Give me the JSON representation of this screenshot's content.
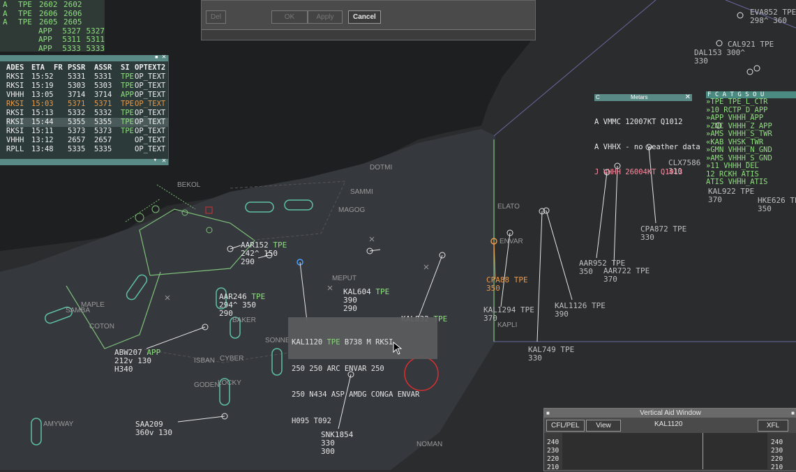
{
  "top_list": {
    "rows": [
      {
        "a": "A",
        "b": "TPE",
        "c": "2602",
        "d": "2602"
      },
      {
        "a": "A",
        "b": "TPE",
        "c": "2606",
        "d": "2606"
      },
      {
        "a": "A",
        "b": "TPE",
        "c": "2605",
        "d": "2605"
      },
      {
        "a": "",
        "b": "APP",
        "c": "5327",
        "d": "5327"
      },
      {
        "a": "",
        "b": "APP",
        "c": "5311",
        "d": "5311"
      },
      {
        "a": "",
        "b": "APP",
        "c": "5333",
        "d": "5333"
      }
    ]
  },
  "flight_list": {
    "headers": [
      "ADES",
      "ETA",
      "FR",
      "PSSR",
      "ASSR",
      "SI",
      "OPTEXT2"
    ],
    "rows": [
      {
        "ades": "RKSI",
        "eta": "15:52",
        "pssr": "5331",
        "assr": "5331",
        "si": "TPE",
        "opt": "OP_TEXT",
        "style": "normal"
      },
      {
        "ades": "RKSI",
        "eta": "15:19",
        "pssr": "5303",
        "assr": "5303",
        "si": "TPE",
        "opt": "OP_TEXT",
        "style": "normal"
      },
      {
        "ades": "VHHH",
        "eta": "13:05",
        "pssr": "3714",
        "assr": "3714",
        "si": "APP",
        "opt": "OP_TEXT",
        "style": "normal"
      },
      {
        "ades": "RKSI",
        "eta": "15:03",
        "pssr": "5371",
        "assr": "5371",
        "si": "TPE",
        "opt": "OP_TEXT",
        "style": "orange"
      },
      {
        "ades": "RKSI",
        "eta": "15:13",
        "pssr": "5332",
        "assr": "5332",
        "si": "TPE",
        "opt": "OP_TEXT",
        "style": "normal"
      },
      {
        "ades": "RKSI",
        "eta": "15:44",
        "pssr": "5355",
        "assr": "5355",
        "si": "TPE",
        "opt": "OP_TEXT",
        "style": "hl"
      },
      {
        "ades": "RKSI",
        "eta": "15:11",
        "pssr": "5373",
        "assr": "5373",
        "si": "TPE",
        "opt": "OP_TEXT",
        "style": "normal"
      },
      {
        "ades": "VHHH",
        "eta": "13:12",
        "pssr": "2657",
        "assr": "2657",
        "si": "",
        "opt": "OP_TEXT",
        "style": "normal"
      },
      {
        "ades": "RPLL",
        "eta": "13:48",
        "pssr": "5335",
        "assr": "5335",
        "si": "",
        "opt": "OP_TEXT",
        "style": "normal"
      }
    ]
  },
  "dialog": {
    "buttons": [
      "Del",
      "OK",
      "Apply",
      "Cancel"
    ]
  },
  "metars": {
    "title": "Metars",
    "lines": [
      {
        "text": "A VMMC 12007KT Q1012",
        "color": "normal"
      },
      {
        "text": "A VHHX - no weather data",
        "color": "normal"
      },
      {
        "text": "J VHHH 26004KT Q1013",
        "color": "pink"
      }
    ]
  },
  "freq_panel": {
    "header": "F C A T G S O U",
    "lines": [
      "»TPE TPE_L_CTR",
      "»10 RCTP_D_APP",
      "»APP VHHH_APP",
      "»ZNC VHHH_Z_APP",
      "»AMS VHHH_S_TWR",
      "«KAB VHSK_TWR",
      "»GMN VHHH_N_GND",
      "»AMS VHHH_S_GND",
      "»11 VHHH_DEL",
      "12 RCKH_ATIS",
      "ATIS VHHH_ATIS"
    ]
  },
  "waypoints": [
    "BEKOL",
    "DOTMI",
    "SAMMI",
    "MAGOG",
    "ELATO",
    "ENVAR",
    "MEPUT",
    "MAPLE",
    "SAMBA",
    "COTON",
    "BAKER",
    "SONNE",
    "ISBAN",
    "CYBER",
    "GODEN",
    "LOCKY",
    "AMYWAY",
    "KAPLI",
    "NOMAN"
  ],
  "aircraft": [
    {
      "cs": "AAR152",
      "si": "TPE",
      "l2": "242^ 150",
      "l3": "290"
    },
    {
      "cs": "AAR246",
      "si": "TPE",
      "l2": "294^ 350",
      "l3": "290"
    },
    {
      "cs": "KAL604",
      "si": "TPE",
      "l2": "390",
      "l3": "290"
    },
    {
      "cs": "ABW207",
      "si": "APP",
      "l2": "212v 130",
      "l3": "H340"
    },
    {
      "cs": "SAA209",
      "si": "",
      "l2": "360v 130",
      "l3": ""
    },
    {
      "cs": "SNK1854",
      "si": "",
      "l2": "330",
      "l3": "300"
    },
    {
      "cs": "CPA88",
      "si": "TPE",
      "l2": "350",
      "l3": ""
    },
    {
      "cs": "KAL1294",
      "si": "TPE",
      "l2": "370",
      "l3": ""
    },
    {
      "cs": "KAL1126",
      "si": "TPE",
      "l2": "390",
      "l3": ""
    },
    {
      "cs": "KAL749",
      "si": "TPE",
      "l2": "330",
      "l3": ""
    },
    {
      "cs": "AAR952",
      "si": "TPE",
      "l2": "350",
      "l3": ""
    },
    {
      "cs": "AAR722",
      "si": "TPE",
      "l2": "370",
      "l3": ""
    },
    {
      "cs": "CPA872",
      "si": "TPE",
      "l2": "330",
      "l3": ""
    },
    {
      "cs": "CLX7586",
      "si": "",
      "l2": "310",
      "l3": ""
    },
    {
      "cs": "DAL153",
      "si": "",
      "l2": "300^",
      "l3": "330"
    },
    {
      "cs": "CAL921",
      "si": "TPE",
      "l2": "",
      "l3": ""
    },
    {
      "cs": "EVA852",
      "si": "TPE",
      "l2": "298^ 360",
      "l3": ""
    },
    {
      "cs": "HKE626",
      "si": "TPE",
      "l2": "350",
      "l3": ""
    },
    {
      "cs": "KAL922",
      "si": "TPE",
      "l2": "370",
      "l3": ""
    },
    {
      "cs": "KAL832",
      "si": "TPE",
      "l2": "",
      "l3": ""
    }
  ],
  "popup": {
    "l1": "KAL1120",
    "l1si": "TPE",
    "l1b": "B738 M RKSI",
    "l2": "250 250 ARC ENVAR 250",
    "l3": "250 N434 ASP AMDG CONGA ENVAR",
    "l4": "H095 T092"
  },
  "vaw": {
    "title": "Vertical Aid Window",
    "cfl_btn": "CFL/PEL",
    "view_btn": "View",
    "callsign": "KAL1120",
    "xfl_btn": "XFL",
    "levels": [
      "240",
      "230",
      "220",
      "210"
    ]
  },
  "colors": {
    "map_bg": "#2b2c2e",
    "land": "#1f2021",
    "sea": "#34363a",
    "sector": "#3a3d43",
    "green_line": "#7fc07a",
    "tag_green": "#8fe07f",
    "orange": "#e89a4b",
    "pink": "#ff8aa0"
  }
}
